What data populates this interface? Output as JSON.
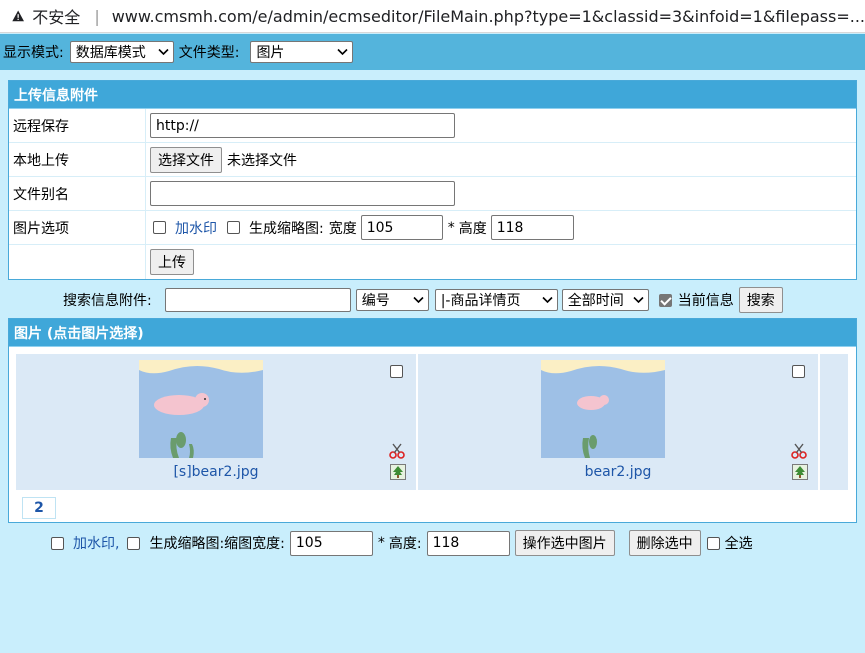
{
  "browser": {
    "security_label": "不安全",
    "url": "www.cmsmh.com/e/admin/ecmseditor/FileMain.php?type=1&classid=3&infoid=1&filepass=..."
  },
  "topbar": {
    "display_mode_label": "显示模式:",
    "display_mode_value": "数据库模式",
    "file_type_label": "文件类型:",
    "file_type_value": "图片"
  },
  "upload": {
    "title": "上传信息附件",
    "remote_label": "远程保存",
    "remote_value": "http://",
    "local_label": "本地上传",
    "choose_file_button": "选择文件",
    "no_file_text": "未选择文件",
    "alias_label": "文件别名",
    "alias_value": "",
    "image_options_label": "图片选项",
    "watermark_label": "加水印",
    "thumbnail_label": "生成缩略图:",
    "width_label": "宽度",
    "width_value": "105",
    "times": "*",
    "height_label": "高度",
    "height_value": "118",
    "upload_button": "上传"
  },
  "search": {
    "label": "搜索信息附件:",
    "keyword_value": "",
    "field_select": "编号",
    "column_select": "|-商品详情页",
    "time_select": "全部时间",
    "current_info_label": "当前信息",
    "current_info_checked": true,
    "search_button": "搜索"
  },
  "gallery": {
    "title": "图片 (点击图片选择)",
    "images": [
      {
        "filename": "[s]bear2.jpg"
      },
      {
        "filename": "bear2.jpg"
      }
    ],
    "page": "2"
  },
  "bottom": {
    "watermark_label": "加水印,",
    "thumbnail_label": "生成缩略图:缩图宽度:",
    "width_value": "105",
    "times": "*",
    "height_label": "高度:",
    "height_value": "118",
    "process_button": "操作选中图片",
    "delete_button": "删除选中",
    "select_all_label": "全选"
  },
  "colors": {
    "page_bg": "#c9eefc",
    "topbar_bg": "#54b4dc",
    "panel_header": "#3fa7d9",
    "link_blue": "#1e56a8",
    "tile_bg": "#dbe9f6"
  }
}
